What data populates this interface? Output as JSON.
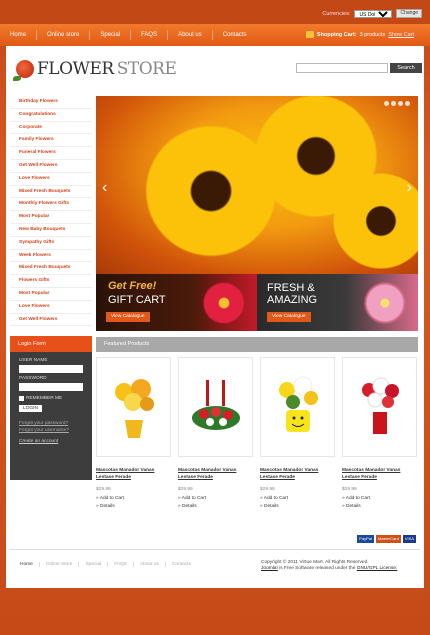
{
  "topbar": {
    "currencies_label": "Currencies:",
    "currency_value": "US Dollar",
    "change_label": "Change"
  },
  "nav": {
    "items": [
      "Home",
      "Online store",
      "Special",
      "FAQS",
      "About us",
      "Contacts"
    ]
  },
  "cart": {
    "label": "Shopping Cart:",
    "count": "3 products",
    "show_label": "Show Cart"
  },
  "logo": {
    "part1": "FLOWER",
    "part2": "STORE"
  },
  "search": {
    "placeholder": "",
    "button": "Search"
  },
  "categories": [
    "Birthday Flowers",
    "Congratulations",
    "Corporate",
    "Family Flowers",
    "Funeral Flowers",
    "Get Well Flowers",
    "Love Flowers",
    "Mixed Fresh Bouquets",
    "Monthly Flowers Gifts",
    "Most Popular",
    "New Baby Bouquets",
    "Sympathy Gifts",
    "Week Flowers",
    "Mixed Fresh Bouquets",
    "Flowers Gifts",
    "Most Popular",
    "Love Flowers",
    "Get Well Flowers"
  ],
  "banners": [
    {
      "line1": "Get Free!",
      "line2": "GIFT CART",
      "button": "View Catalogue"
    },
    {
      "line1": "FRESH &",
      "line2": "AMAZING",
      "button": "View Catalogue"
    }
  ],
  "login": {
    "title": "Login Form",
    "user_label": "USER NAME",
    "password_label": "PASSWORD",
    "remember": "REMEMBER ME",
    "button": "LOGIN",
    "forgot_password": "Forgot your password?",
    "forgot_username": "Forgot your username?",
    "create": "Create an account"
  },
  "featured": {
    "title": "Featured Products"
  },
  "products": [
    {
      "name": "Mascotas Manador Vanas Lestase Ferade",
      "price": "$29.99",
      "add": "Add to Cart",
      "details": "Details"
    },
    {
      "name": "Mascotas Manador Vanas Lestase Ferade",
      "price": "$29.99",
      "add": "Add to Cart",
      "details": "Details"
    },
    {
      "name": "Mascotas Manador Vanas Lestase Ferade",
      "price": "$29.99",
      "add": "Add to Cart",
      "details": "Details"
    },
    {
      "name": "Mascotas Manador Vanas Lestase Ferade",
      "price": "$29.99",
      "add": "Add to Cart",
      "details": "Details"
    }
  ],
  "payments": [
    "PayPal",
    "MasterCard",
    "VISA"
  ],
  "footer": {
    "nav": [
      "Home",
      "Online Store",
      "Special",
      "FAQS",
      "About us",
      "Contacts"
    ],
    "copyright": "Copyright © 2011 Virtue Mart. All Rights Reserved.",
    "license_prefix": "Joomla!",
    "license_middle": " is Free Software released under the ",
    "license_link": "GNU/GPL License."
  }
}
